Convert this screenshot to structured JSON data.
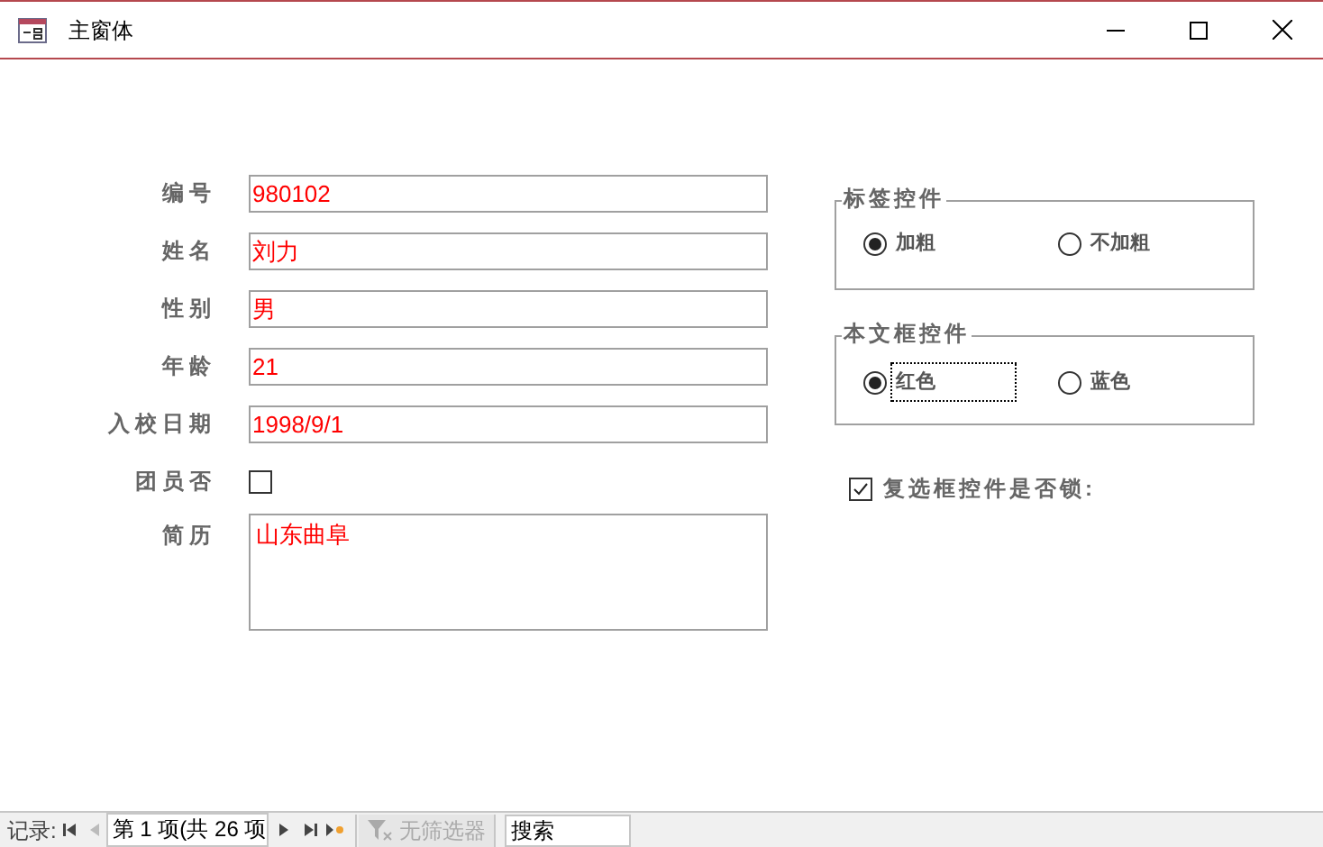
{
  "window": {
    "title": "主窗体"
  },
  "fields": [
    {
      "label": "编号",
      "value": "980102"
    },
    {
      "label": "姓名",
      "value": "刘力"
    },
    {
      "label": "性别",
      "value": "男"
    },
    {
      "label": "年龄",
      "value": "21"
    },
    {
      "label": "入校日期",
      "value": "1998/9/1"
    }
  ],
  "member": {
    "label": "团员否",
    "checked": false
  },
  "resume": {
    "label": "简历",
    "value": "山东曲阜"
  },
  "groups": [
    {
      "title": "标签控件",
      "options": [
        {
          "label": "加粗",
          "selected": true,
          "focused": false
        },
        {
          "label": "不加粗",
          "selected": false,
          "focused": false
        }
      ]
    },
    {
      "title": "本文框控件",
      "options": [
        {
          "label": "红色",
          "selected": true,
          "focused": true
        },
        {
          "label": "蓝色",
          "selected": false,
          "focused": false
        }
      ]
    }
  ],
  "lock_checkbox": {
    "label": "复选框控件是否锁:",
    "checked": true
  },
  "record_nav": {
    "label": "记录:",
    "position": "第 1 项(共 26 项",
    "filter": "无筛选器",
    "search": {
      "placeholder": "搜索"
    }
  }
}
